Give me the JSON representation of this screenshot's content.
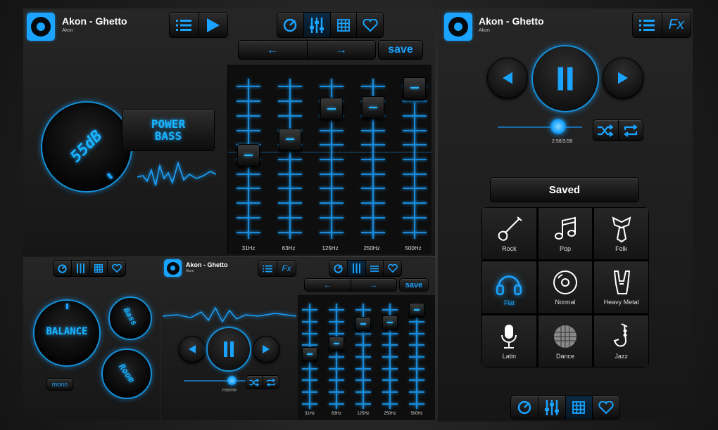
{
  "track": {
    "title": "Akon - Ghetto",
    "artist": "Akon"
  },
  "effects": {
    "power_bass_line1": "POWER",
    "power_bass_line2": "BASS",
    "bass_level": "55dB",
    "balance_label": "BALANCE",
    "mono_label": "mono",
    "knob2_label": "Bass",
    "knob3_label": "Room"
  },
  "eq": {
    "prev_label": "←",
    "next_label": "→",
    "save_label": "save",
    "bands": [
      {
        "label": "31Hz",
        "level": 0.52
      },
      {
        "label": "63Hz",
        "level": 0.62
      },
      {
        "label": "125Hz",
        "level": 0.81
      },
      {
        "label": "250Hz",
        "level": 0.82
      },
      {
        "label": "500Hz",
        "level": 0.94
      }
    ]
  },
  "player": {
    "time": "2:58/3:58",
    "progress": 0.72,
    "fx_label": "Fx",
    "saved_label": "Saved"
  },
  "presets": [
    {
      "label": "Rock",
      "icon": "guitar-icon"
    },
    {
      "label": "Pop",
      "icon": "music-notes-icon"
    },
    {
      "label": "Folk",
      "icon": "tie-icon"
    },
    {
      "label": "Flat",
      "icon": "headphones-icon",
      "active": true
    },
    {
      "label": "Normal",
      "icon": "disc-icon"
    },
    {
      "label": "Heavy Metal",
      "icon": "rock-hand-icon"
    },
    {
      "label": "Latin",
      "icon": "microphone-icon"
    },
    {
      "label": "Dance",
      "icon": "disco-ball-icon"
    },
    {
      "label": "Jazz",
      "icon": "saxophone-icon"
    }
  ],
  "colors": {
    "accent": "#1aa3ff",
    "background": "#1a1a1a"
  }
}
